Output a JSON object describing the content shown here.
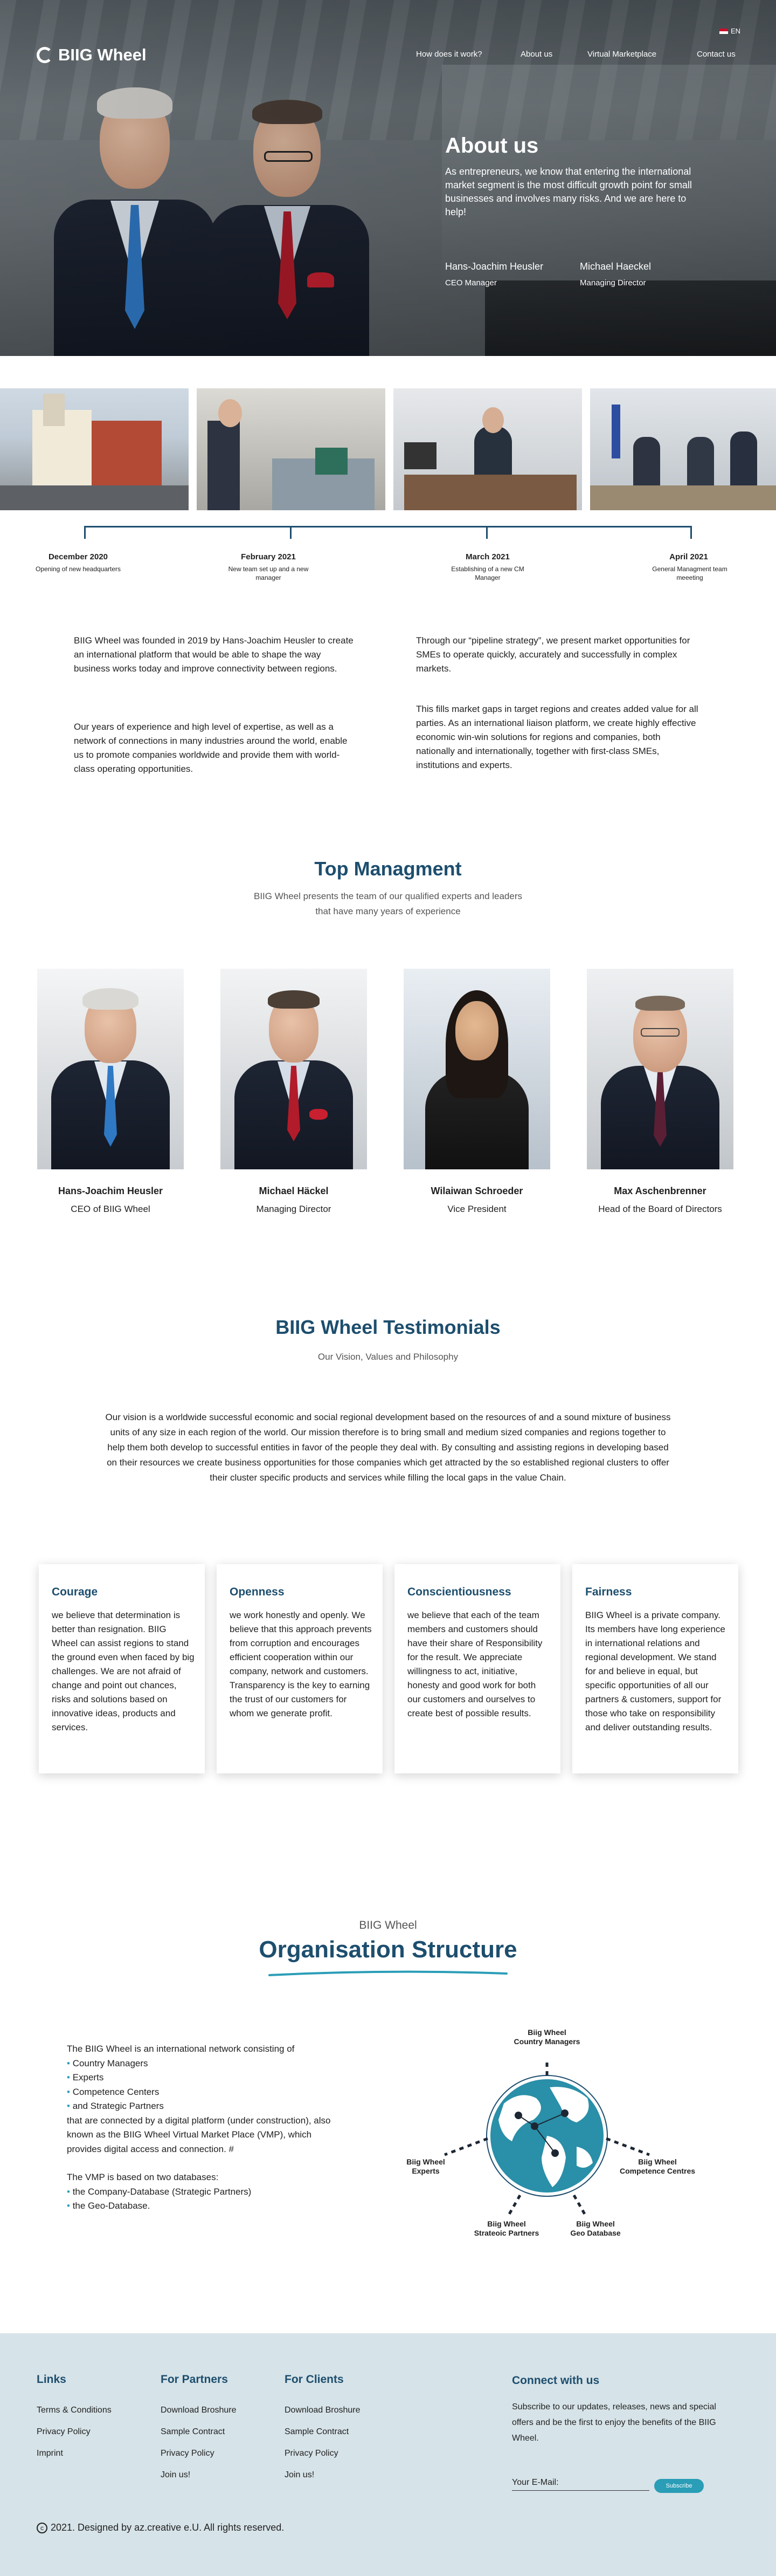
{
  "colors": {
    "accent": "#1d4e6e",
    "teal": "#2a9db7",
    "footer_bg": "#d6e3e8"
  },
  "header": {
    "logo": "BIIG Wheel",
    "nav": [
      "How does it work?",
      "About us",
      "Virtual Marketplace",
      "Contact us"
    ],
    "language": "EN"
  },
  "about": {
    "title": "About us",
    "text": "As entrepreneurs,   we know that entering the international market segment is the   most difficult growth point for small businesses and involves many risks.   And we are here to help!",
    "people": [
      {
        "name": "Hans-Joachim Heusler",
        "role": "CEO Manager"
      },
      {
        "name": "Michael Haeckel",
        "role": "Managing Director"
      }
    ]
  },
  "timeline": [
    {
      "date": "December 2020",
      "desc": "Opening of new headquarters"
    },
    {
      "date": "February 2021",
      "desc": "New team set up and a new manager"
    },
    {
      "date": "March 2021",
      "desc": "Establishing of a new CM Manager"
    },
    {
      "date": "April 2021",
      "desc": "General Managment team meeeting"
    }
  ],
  "intro": {
    "left1": "BIIG Wheel was founded in 2019 by Hans-Joachim Heusler to create an   international platform that would be able to shape the way business   works today and improve connectivity between regions.",
    "left2": "Our years of experience and high level of expertise, as well as a network   of connections in many industries around the world, enable us   to promote companies worldwide and provide them with world-class   operating opportunities.",
    "right1": "Through our “pipeline strategy”, we present market opportunities for SMEs to operate quickly, accurately and successfully in complex markets.",
    "right2": "This fills market gaps in target regions and creates added value for all parties. As an international liaison platform, we create highly effective economic win-win solutions for regions and companies, both nationally and internationally, together with first-class SMEs, institutions and experts."
  },
  "management": {
    "title": "Top Managment",
    "subtitle": "BIIG Wheel presents the team of our qualified experts and leaders that have many years of experience",
    "members": [
      {
        "name": "Hans-Joachim Heusler",
        "role": "CEO of BIIG Wheel"
      },
      {
        "name": "Michael Häckel",
        "role": "Managing Director"
      },
      {
        "name": "Wilaiwan Schroeder",
        "role": "Vice President"
      },
      {
        "name": "Max Aschenbrenner",
        "role": "Head of the Board of Directors"
      }
    ]
  },
  "testimonials": {
    "title": "BIIG Wheel Testimonials",
    "subtitle": "Our Vision, Values and Philosophy",
    "vision": "Our vision is a worldwide successful economic and social regional development based on the resources of and a sound mixture of business units of any size in each region of the world. Our mission therefore is to bring small and medium sized companies and regions together to help them both develop to successful entities in favor of the people they deal with. By consulting and assisting regions in developing based on their resources we create business opportunities for those companies which get attracted by the so established regional clusters to offer their cluster specific products and services while filling the local gaps in the value Chain.",
    "cards": [
      {
        "title": "Courage",
        "text": "we believe that determination is better than resignation. BIIG Wheel can assist regions to stand the ground even when faced by big challenges. We are not afraid of change and point out chances, risks and solutions based on innovative ideas, products and services."
      },
      {
        "title": "Openness",
        "text": "we work honestly and openly. We believe that this approach prevents from corruption and encourages efficient cooperation within our company, network and customers. Transparency is the key to earning the trust of   our customers for whom we generate profit."
      },
      {
        "title": "Conscientiousness",
        "text": "we believe that each of the team members and customers should have their share of Responsibility for the result. We appreciate willingness to act, initiative, honesty and good work for both our customers and ourselves to create best of possible results."
      },
      {
        "title": "Fairness",
        "text": "BIIG Wheel is a private company. Its members have long experience in international relations and regional development. We stand for and believe in equal, but specific opportunities of all our partners & customers, support for those who take on responsibility and deliver outstanding results."
      }
    ]
  },
  "org": {
    "kicker": "BIIG Wheel",
    "title": "Organisation Structure",
    "intro": "The BIIG Wheel is an international network consisting of",
    "items": [
      "Country Managers",
      "Experts",
      "Competence Centers",
      "and Strategic Partners"
    ],
    "mid": "that are connected by a digital platform (under construction), also   known as the BIIG Wheel Virtual Market Place (VMP), which provides   digital access and connection. #",
    "db_intro": "The VMP is based on two databases:",
    "databases": [
      "the Company-Database (Strategic Partners)",
      "the Geo-Database."
    ],
    "diagram": {
      "top": "Biig Wheel\nCountry Managers",
      "left": "Biig Wheel\nExperts",
      "right": "Biig Wheel\nCompetence Centres",
      "bottom_left": "Biig Wheel\nStrateoic Partners",
      "bottom_right": "Biig Wheel\nGeo Database"
    }
  },
  "footer": {
    "links_title": "Links",
    "links": [
      "Terms & Conditions",
      "Privacy Policy",
      "Imprint"
    ],
    "partners_title": "For Partners",
    "partners": [
      "Download Broshure",
      "Sample Contract",
      "Privacy Policy",
      "Join us!"
    ],
    "clients_title": "For Clients",
    "clients": [
      "Download Broshure",
      "Sample Contract",
      "Privacy Policy",
      "Join us!"
    ],
    "connect_title": "Connect with us",
    "connect_text": "Subscribe to our updates, releases, news and special offers and be the first to enjoy the benefits of the BIIG Wheel.",
    "email_label": "Your E-Mail:",
    "subscribe": "Subscribe",
    "copyright": "2021. Designed by az.creative e.U.  All rights reserved."
  }
}
